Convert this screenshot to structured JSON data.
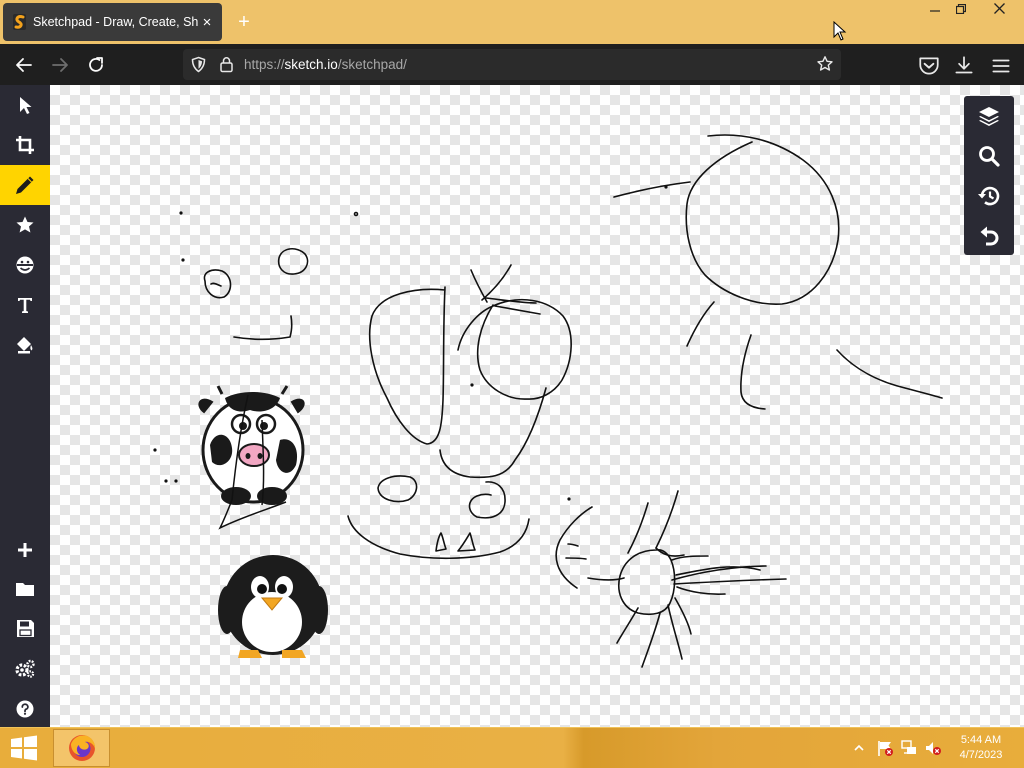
{
  "browser": {
    "tab_title": "Sketchpad - Draw, Create, Share!",
    "tab_close": "×",
    "new_tab": "+",
    "url_scheme": "https://",
    "url_host": "sketch.io",
    "url_path": "/sketchpad/",
    "window_controls": {
      "minimize": "—",
      "maximize": "❐",
      "close": "✕"
    }
  },
  "nav": {
    "back_icon": "arrow-left-icon",
    "forward_icon": "arrow-right-icon",
    "reload_icon": "reload-icon",
    "shield_icon": "tracking-shield-icon",
    "lock_icon": "lock-icon",
    "bookmark_icon": "star-outline-icon",
    "pocket_icon": "pocket-icon",
    "downloads_icon": "download-icon",
    "menu_icon": "hamburger-menu-icon"
  },
  "sidebar": {
    "active_color": "#ffd400",
    "tools": [
      {
        "name": "select",
        "icon": "pointer-icon"
      },
      {
        "name": "crop",
        "icon": "crop-icon"
      },
      {
        "name": "pencil",
        "icon": "pencil-icon",
        "active": true
      },
      {
        "name": "stamp",
        "icon": "star-icon"
      },
      {
        "name": "sticker",
        "icon": "sticker-icon"
      },
      {
        "name": "text",
        "icon": "text-icon",
        "label": "T"
      },
      {
        "name": "fill",
        "icon": "paint-bucket-icon"
      }
    ],
    "bottom_tools": [
      {
        "name": "new",
        "icon": "plus-icon"
      },
      {
        "name": "open",
        "icon": "folder-icon"
      },
      {
        "name": "save",
        "icon": "save-icon"
      },
      {
        "name": "settings",
        "icon": "gears-icon"
      },
      {
        "name": "help",
        "icon": "help-icon",
        "label": "?"
      }
    ]
  },
  "right_panel": {
    "tools": [
      {
        "name": "layers",
        "icon": "layers-icon"
      },
      {
        "name": "zoom",
        "icon": "magnifier-icon"
      },
      {
        "name": "history",
        "icon": "history-icon"
      },
      {
        "name": "undo",
        "icon": "undo-icon"
      }
    ]
  },
  "canvas": {
    "stickers": [
      "cow-sticker",
      "penguin-sticker"
    ]
  },
  "taskbar": {
    "start_icon": "windows-logo-icon",
    "pinned": [
      "firefox-icon"
    ],
    "tray_icons": [
      "tray-chevron-icon",
      "action-center-flag-icon",
      "network-icon",
      "volume-muted-icon"
    ],
    "time": "5:44 AM",
    "date": "4/7/2023"
  }
}
